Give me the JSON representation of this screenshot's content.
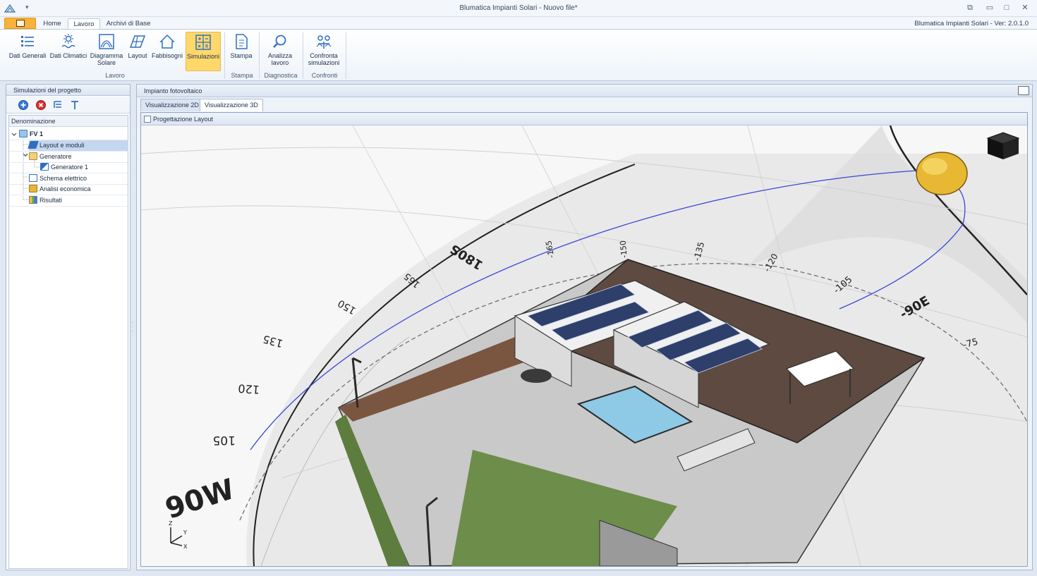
{
  "window": {
    "title": "Blumatica Impianti Solari - Nuovo file*",
    "version": "Blumatica Impianti Solari - Ver: 2.0.1.0"
  },
  "ribbon": {
    "tabs": [
      {
        "label": "Home"
      },
      {
        "label": "Lavoro"
      },
      {
        "label": "Archivi di Base"
      }
    ],
    "buttons": {
      "dati_generali": "Dati Generali",
      "dati_climatici": "Dati Climatici",
      "diagramma_solare": "Diagramma Solare",
      "layout": "Layout",
      "fabbisogni": "Fabbisogni",
      "simulazioni": "Simulazioni",
      "stampa": "Stampa",
      "analizza_lavoro": "Analizza lavoro",
      "confronta_simulazioni": "Confronta simulazioni"
    },
    "groups": {
      "lavoro": "Lavoro",
      "stampa": "Stampa",
      "diagnostica": "Diagnostica",
      "confronti": "Confronti"
    }
  },
  "left_panel": {
    "title": "Simulazioni del progetto",
    "column_header": "Denominazione",
    "tree": [
      {
        "label": "FV 1"
      },
      {
        "label": "Layout e moduli"
      },
      {
        "label": "Generatore"
      },
      {
        "label": "Generatore 1"
      },
      {
        "label": "Schema elettrico"
      },
      {
        "label": "Analisi economica"
      },
      {
        "label": "Risultati"
      }
    ]
  },
  "main_panel": {
    "title": "Impianto fotovoltaico",
    "view_tabs": [
      {
        "label": "Visualizzazione 2D"
      },
      {
        "label": "Visualizzazione 3D"
      }
    ],
    "viewport_title": "Progettazione Layout",
    "compass_labels": [
      "90W",
      "105",
      "120",
      "135",
      "150",
      "165",
      "180S",
      "-165",
      "-150",
      "-135",
      "-120",
      "-105",
      "-90E",
      "-75"
    ],
    "axis_labels": {
      "z": "Z",
      "y": "Y",
      "x": "X"
    }
  },
  "colors": {
    "ribbon_active": "#ffd86b",
    "accent_blue": "#2f6fbf",
    "sun_path": "#3b46d6",
    "sun": "#e8b833"
  }
}
